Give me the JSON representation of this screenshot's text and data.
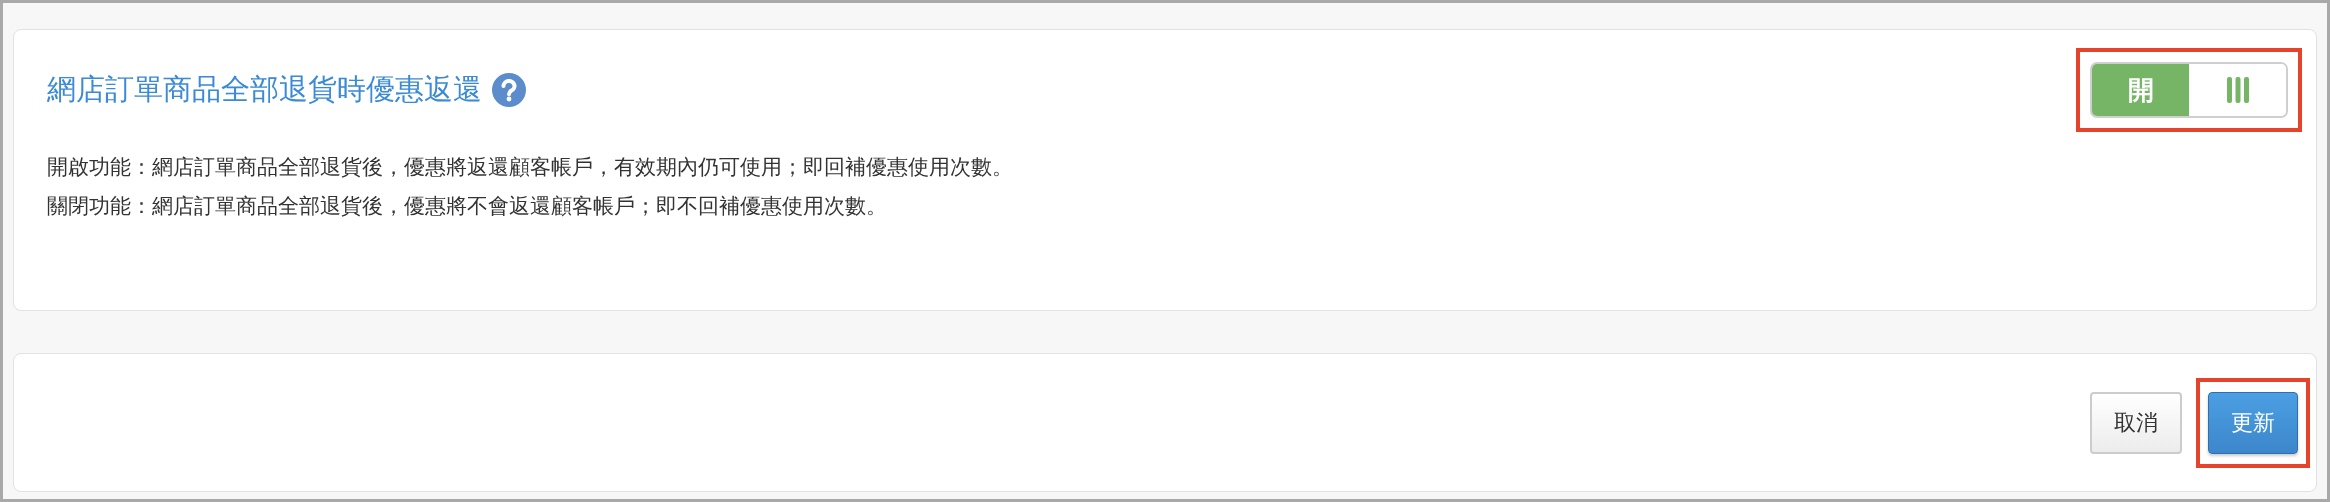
{
  "setting": {
    "title": "網店訂單商品全部退貨時優惠返還",
    "toggle": {
      "on": true,
      "on_label": "開",
      "highlighted": true
    },
    "descriptions": [
      "開啟功能：網店訂單商品全部退貨後，優惠將返還顧客帳戶，有效期內仍可使用；即回補優惠使用次數。",
      "關閉功能：網店訂單商品全部退貨後，優惠將不會返還顧客帳戶；即不回補優惠使用次數。"
    ]
  },
  "actions": [
    {
      "label": "取消",
      "kind": "default",
      "highlighted": false
    },
    {
      "label": "更新",
      "kind": "primary",
      "highlighted": true
    }
  ]
}
